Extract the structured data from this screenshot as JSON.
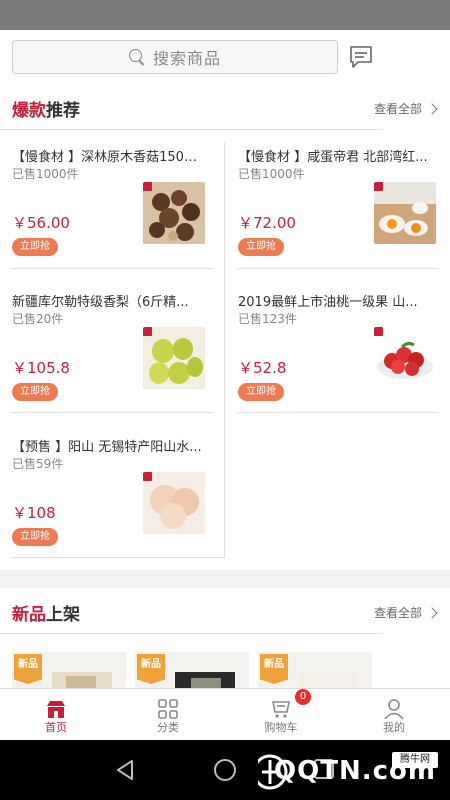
{
  "search": {
    "placeholder": "搜索商品"
  },
  "hot": {
    "title_highlight": "爆款",
    "title_rest": "推荐",
    "more": "查看全部"
  },
  "products": [
    {
      "name": "【慢食材 】深林原木香菇150g...",
      "sold": "已售1000件",
      "price": "￥56.00",
      "buy": "立即抢"
    },
    {
      "name": "【慢食材 】咸蛋帝君 北部湾红...",
      "sold": "已售1000件",
      "price": "￥72.00",
      "buy": "立即抢"
    },
    {
      "name": "新疆库尔勒特级香梨（6斤精...",
      "sold": "已售20件",
      "price": "￥105.8",
      "buy": "立即抢"
    },
    {
      "name": "2019最鲜上市油桃一级果 山...",
      "sold": "已售123件",
      "price": "￥52.8",
      "buy": "立即抢"
    },
    {
      "name": "【预售 】阳山 无锡特产阳山水...",
      "sold": "已售59件",
      "price": "￥108",
      "buy": "立即抢"
    }
  ],
  "new": {
    "title_highlight": "新品",
    "title_rest": "上架",
    "more": "查看全部",
    "tag": "新品"
  },
  "tabs": [
    {
      "label": "首页",
      "icon": "home-icon",
      "active": true
    },
    {
      "label": "分类",
      "icon": "grid-icon",
      "active": false
    },
    {
      "label": "购物车",
      "icon": "cart-icon",
      "active": false,
      "badge": "0"
    },
    {
      "label": "我的",
      "icon": "user-icon",
      "active": false
    }
  ],
  "watermark": {
    "text": "QQTN.com",
    "sub": "腾牛网"
  },
  "colors": {
    "accent": "#c8203a",
    "buy_button": "#ee7a52",
    "new_tag": "#f0a23a"
  }
}
